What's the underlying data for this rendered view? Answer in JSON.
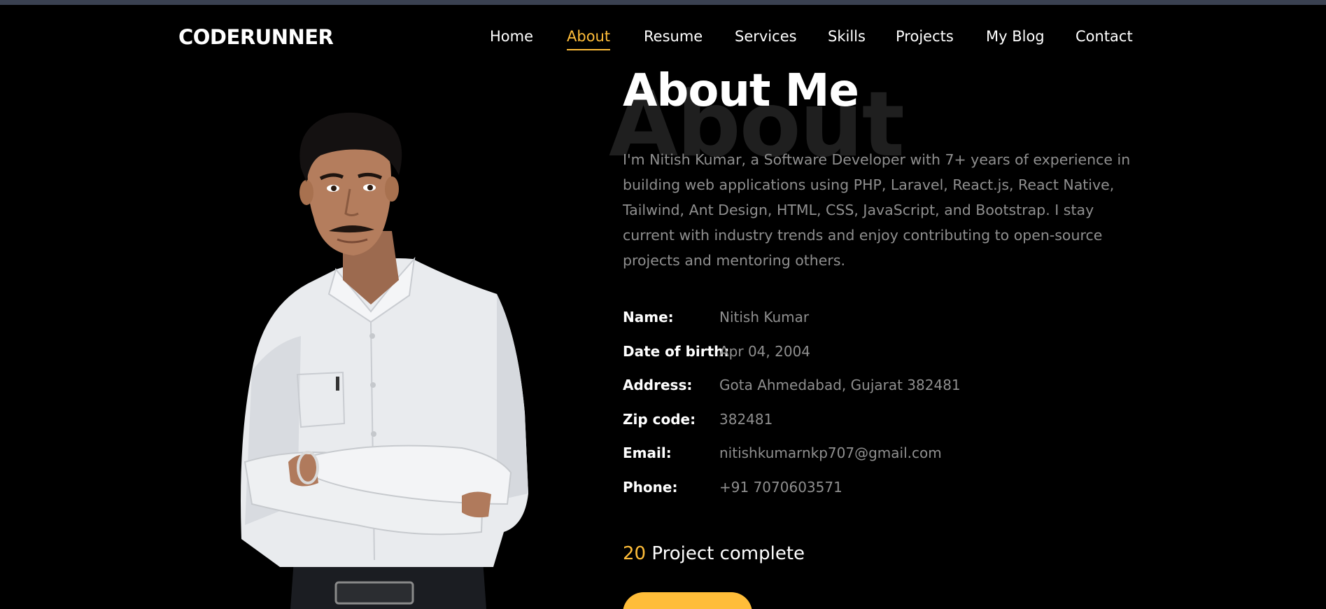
{
  "brand": {
    "logo_text": "CODERUNNER"
  },
  "nav": {
    "items": [
      {
        "label": "Home"
      },
      {
        "label": "About"
      },
      {
        "label": "Resume"
      },
      {
        "label": "Services"
      },
      {
        "label": "Skills"
      },
      {
        "label": "Projects"
      },
      {
        "label": "My Blog"
      },
      {
        "label": "Contact"
      }
    ],
    "active": "About"
  },
  "about": {
    "background_word": "About",
    "title": "About Me",
    "bio": "I'm Nitish Kumar, a Software Developer with 7+ years of experience in building web applications using PHP, Laravel, React.js, React Native, Tailwind, Ant Design, HTML, CSS, JavaScript, and Bootstrap. I stay current with industry trends and enjoy contributing to open-source projects and mentoring others.",
    "details": [
      {
        "label": "Name:",
        "value": "Nitish Kumar"
      },
      {
        "label": "Date of birth:",
        "value": "Apr 04, 2004"
      },
      {
        "label": "Address:",
        "value": "Gota Ahmedabad, Gujarat 382481"
      },
      {
        "label": "Zip code:",
        "value": "382481"
      },
      {
        "label": "Email:",
        "value": "nitishkumarnkp707@gmail.com"
      },
      {
        "label": "Phone:",
        "value": "+91 7070603571"
      }
    ],
    "counter": {
      "number": "20",
      "text": "Project complete"
    }
  },
  "colors": {
    "accent": "#ffbd39",
    "background": "#000000",
    "muted_text": "#8f8f8f",
    "topbar": "#3a4151"
  }
}
